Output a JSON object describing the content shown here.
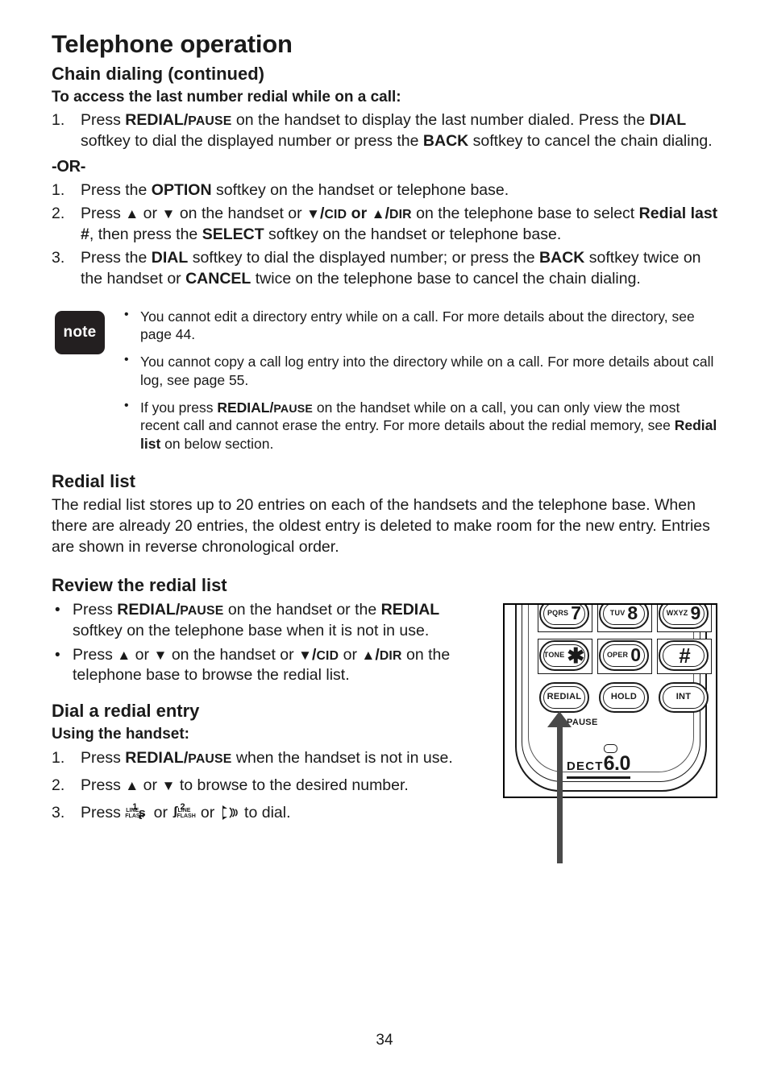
{
  "header": {
    "chapter_title": "Telephone operation",
    "section_title": "Chain dialing (continued)"
  },
  "access_section": {
    "heading": "To access the last number redial while on a call:",
    "steps": [
      {
        "number": "1.",
        "parts": [
          {
            "t": "Press ",
            "s": "n"
          },
          {
            "t": "REDIAL/",
            "s": "b"
          },
          {
            "t": "PAUSE",
            "s": "sc"
          },
          {
            "t": " on the handset to display the last number dialed. Press the ",
            "s": "n"
          },
          {
            "t": "DIAL",
            "s": "b"
          },
          {
            "t": " softkey to dial the displayed number or press the ",
            "s": "n"
          },
          {
            "t": "BACK",
            "s": "b"
          },
          {
            "t": " softkey to cancel the chain dialing.",
            "s": "n"
          }
        ]
      }
    ],
    "or_label": "-OR-",
    "or_steps": [
      {
        "number": "1.",
        "parts": [
          {
            "t": "Press the ",
            "s": "n"
          },
          {
            "t": "OPTION",
            "s": "b"
          },
          {
            "t": " softkey on the handset or telephone base.",
            "s": "n"
          }
        ]
      },
      {
        "number": "2.",
        "parts": [
          {
            "t": "Press ",
            "s": "n"
          },
          {
            "t": "▲",
            "s": "arrow"
          },
          {
            "t": " or ",
            "s": "n"
          },
          {
            "t": "▼",
            "s": "arrow"
          },
          {
            "t": " on the handset or ",
            "s": "n"
          },
          {
            "t": "▼",
            "s": "arrow"
          },
          {
            "t": "/",
            "s": "b"
          },
          {
            "t": "CID",
            "s": "sc"
          },
          {
            "t": " ",
            "s": "n"
          },
          {
            "t": "or",
            "s": "b"
          },
          {
            "t": " ",
            "s": "n"
          },
          {
            "t": "▲",
            "s": "arrow"
          },
          {
            "t": "/",
            "s": "b"
          },
          {
            "t": "DIR",
            "s": "sc"
          },
          {
            "t": " on the telephone base to select ",
            "s": "n"
          },
          {
            "t": "Redial last #",
            "s": "b"
          },
          {
            "t": ", then press the ",
            "s": "n"
          },
          {
            "t": "SELECT",
            "s": "b"
          },
          {
            "t": " softkey on the handset or telephone base.",
            "s": "n"
          }
        ]
      },
      {
        "number": "3.",
        "parts": [
          {
            "t": "Press the ",
            "s": "n"
          },
          {
            "t": "DIAL",
            "s": "b"
          },
          {
            "t": " softkey to dial the displayed number; or press the ",
            "s": "n"
          },
          {
            "t": "BACK",
            "s": "b"
          },
          {
            "t": " softkey twice on the handset or ",
            "s": "n"
          },
          {
            "t": "CANCEL",
            "s": "b"
          },
          {
            "t": " twice on the telephone base to cancel the chain dialing.",
            "s": "n"
          }
        ]
      }
    ]
  },
  "note": {
    "badge_label": "note",
    "items": [
      {
        "parts": [
          {
            "t": "You cannot edit a directory entry while on a call. For more details about the directory, see page 44.",
            "s": "n"
          }
        ]
      },
      {
        "parts": [
          {
            "t": "You cannot copy a call log entry into the directory while on a call. For more details about call log, see page 55.",
            "s": "n"
          }
        ]
      },
      {
        "parts": [
          {
            "t": "If you press ",
            "s": "n"
          },
          {
            "t": "REDIAL/",
            "s": "b"
          },
          {
            "t": "PAUSE",
            "s": "sc"
          },
          {
            "t": " on the handset while on a call, you can only view the most recent call and cannot erase the entry. For more details about the redial memory, see ",
            "s": "n"
          },
          {
            "t": "Redial list",
            "s": "b"
          },
          {
            "t": " on below section.",
            "s": "n"
          }
        ]
      }
    ]
  },
  "redial_list": {
    "heading": "Redial list",
    "paragraph": "The redial list stores up to 20 entries on each of the handsets and the telephone base. When there are already 20 entries, the oldest entry is deleted to make room for the new entry. Entries are shown in reverse chronological order."
  },
  "review_section": {
    "heading": "Review the redial list",
    "bullets": [
      {
        "parts": [
          {
            "t": "Press ",
            "s": "n"
          },
          {
            "t": "REDIAL/",
            "s": "b"
          },
          {
            "t": "PAUSE",
            "s": "sc"
          },
          {
            "t": " on the handset or the ",
            "s": "n"
          },
          {
            "t": "REDIAL",
            "s": "b"
          },
          {
            "t": " softkey on the telephone base when it is not in use.",
            "s": "n"
          }
        ]
      },
      {
        "parts": [
          {
            "t": "Press ",
            "s": "n"
          },
          {
            "t": "▲",
            "s": "arrow"
          },
          {
            "t": " or ",
            "s": "n"
          },
          {
            "t": "▼",
            "s": "arrow"
          },
          {
            "t": " on the handset or ",
            "s": "n"
          },
          {
            "t": "▼",
            "s": "arrow"
          },
          {
            "t": "/",
            "s": "b"
          },
          {
            "t": "CID",
            "s": "sc"
          },
          {
            "t": " or ",
            "s": "n"
          },
          {
            "t": "▲",
            "s": "arrow"
          },
          {
            "t": "/",
            "s": "b"
          },
          {
            "t": "DIR",
            "s": "sc"
          },
          {
            "t": " on the telephone base to browse the redial list.",
            "s": "n"
          }
        ]
      }
    ]
  },
  "dial_section": {
    "heading": "Dial a redial entry",
    "subheading": "Using the handset:",
    "steps": [
      {
        "number": "1.",
        "parts": [
          {
            "t": "Press ",
            "s": "n"
          },
          {
            "t": "REDIAL/",
            "s": "b"
          },
          {
            "t": "PAUSE",
            "s": "sc"
          },
          {
            "t": " when the handset is not in use.",
            "s": "n"
          }
        ]
      },
      {
        "number": "2.",
        "parts": [
          {
            "t": "Press ",
            "s": "n"
          },
          {
            "t": "▲",
            "s": "arrow"
          },
          {
            "t": " or ",
            "s": "n"
          },
          {
            "t": "▼",
            "s": "arrow"
          },
          {
            "t": " to browse to the desired number.",
            "s": "n"
          }
        ]
      },
      {
        "number": "3.",
        "parts": [
          {
            "t": "Press ",
            "s": "n"
          },
          {
            "t": "line1-flash-icon",
            "s": "icon"
          },
          {
            "t": " or ",
            "s": "n"
          },
          {
            "t": "line2-flash-icon",
            "s": "icon"
          },
          {
            "t": " or ",
            "s": "n"
          },
          {
            "t": "speakerphone-icon",
            "s": "icon"
          },
          {
            "t": " to dial.",
            "s": "n"
          }
        ]
      }
    ]
  },
  "illustration": {
    "keypad": {
      "rows": [
        [
          {
            "letters": "PQRS",
            "digit": "7"
          },
          {
            "letters": "TUV",
            "digit": "8"
          },
          {
            "letters": "WXYZ",
            "digit": "9"
          }
        ],
        [
          {
            "letters": "TONE",
            "digit": "✱"
          },
          {
            "letters": "OPER",
            "digit": "0"
          },
          {
            "letters": "",
            "digit": "#"
          }
        ]
      ],
      "function_row": [
        "REDIAL",
        "HOLD",
        "INT"
      ],
      "pause_label": "PAUSE"
    },
    "brand": {
      "prefix": "DECT",
      "version": "6.0"
    }
  },
  "footer": {
    "page_number": "34"
  }
}
